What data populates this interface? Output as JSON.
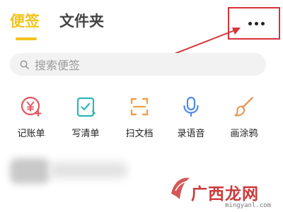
{
  "tabs": [
    {
      "label": "便签",
      "active": true
    },
    {
      "label": "文件夹",
      "active": false
    }
  ],
  "search": {
    "placeholder": "搜索便签"
  },
  "tools": [
    {
      "label": "记账单",
      "icon": "bookkeeping-icon",
      "color": "#e2545b"
    },
    {
      "label": "写清单",
      "icon": "checklist-icon",
      "color": "#2db5b8"
    },
    {
      "label": "扫文档",
      "icon": "scan-icon",
      "color": "#eea049"
    },
    {
      "label": "录语音",
      "icon": "microphone-icon",
      "color": "#4f88ec"
    },
    {
      "label": "画涂鸦",
      "icon": "brush-icon",
      "color": "#e39a5a"
    }
  ],
  "watermark": {
    "text": "广西龙网",
    "url": "mingyanl.com"
  },
  "colors": {
    "accent": "#f2c31a",
    "annotation": "#d8323a"
  }
}
